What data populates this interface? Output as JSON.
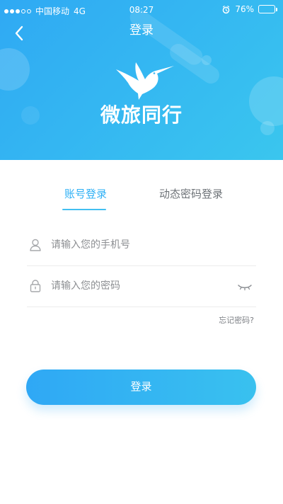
{
  "status_bar": {
    "carrier": "中国移动",
    "network": "4G",
    "time": "08:27",
    "battery_text": "76%",
    "battery_level": 0.76
  },
  "nav": {
    "title": "登录",
    "back_icon": "chevron-left-icon"
  },
  "brand": {
    "name": "微旅同行",
    "logo_icon": "hummingbird-icon"
  },
  "tabs": [
    {
      "label": "账号登录",
      "active": true
    },
    {
      "label": "动态密码登录",
      "active": false
    }
  ],
  "form": {
    "phone_placeholder": "请输入您的手机号",
    "phone_value": "",
    "phone_icon": "user-icon",
    "password_placeholder": "请输入您的密码",
    "password_value": "",
    "password_icon": "lock-icon",
    "password_toggle_icon": "eye-closed-icon",
    "forgot_password": "忘记密码?"
  },
  "actions": {
    "login_label": "登录"
  },
  "colors": {
    "header_gradient_start": "#2fa9f3",
    "header_gradient_end": "#3ac6ee",
    "accent": "#2eb0f5",
    "button_gradient_start": "#2fa8f5",
    "button_gradient_end": "#39c1ef"
  }
}
